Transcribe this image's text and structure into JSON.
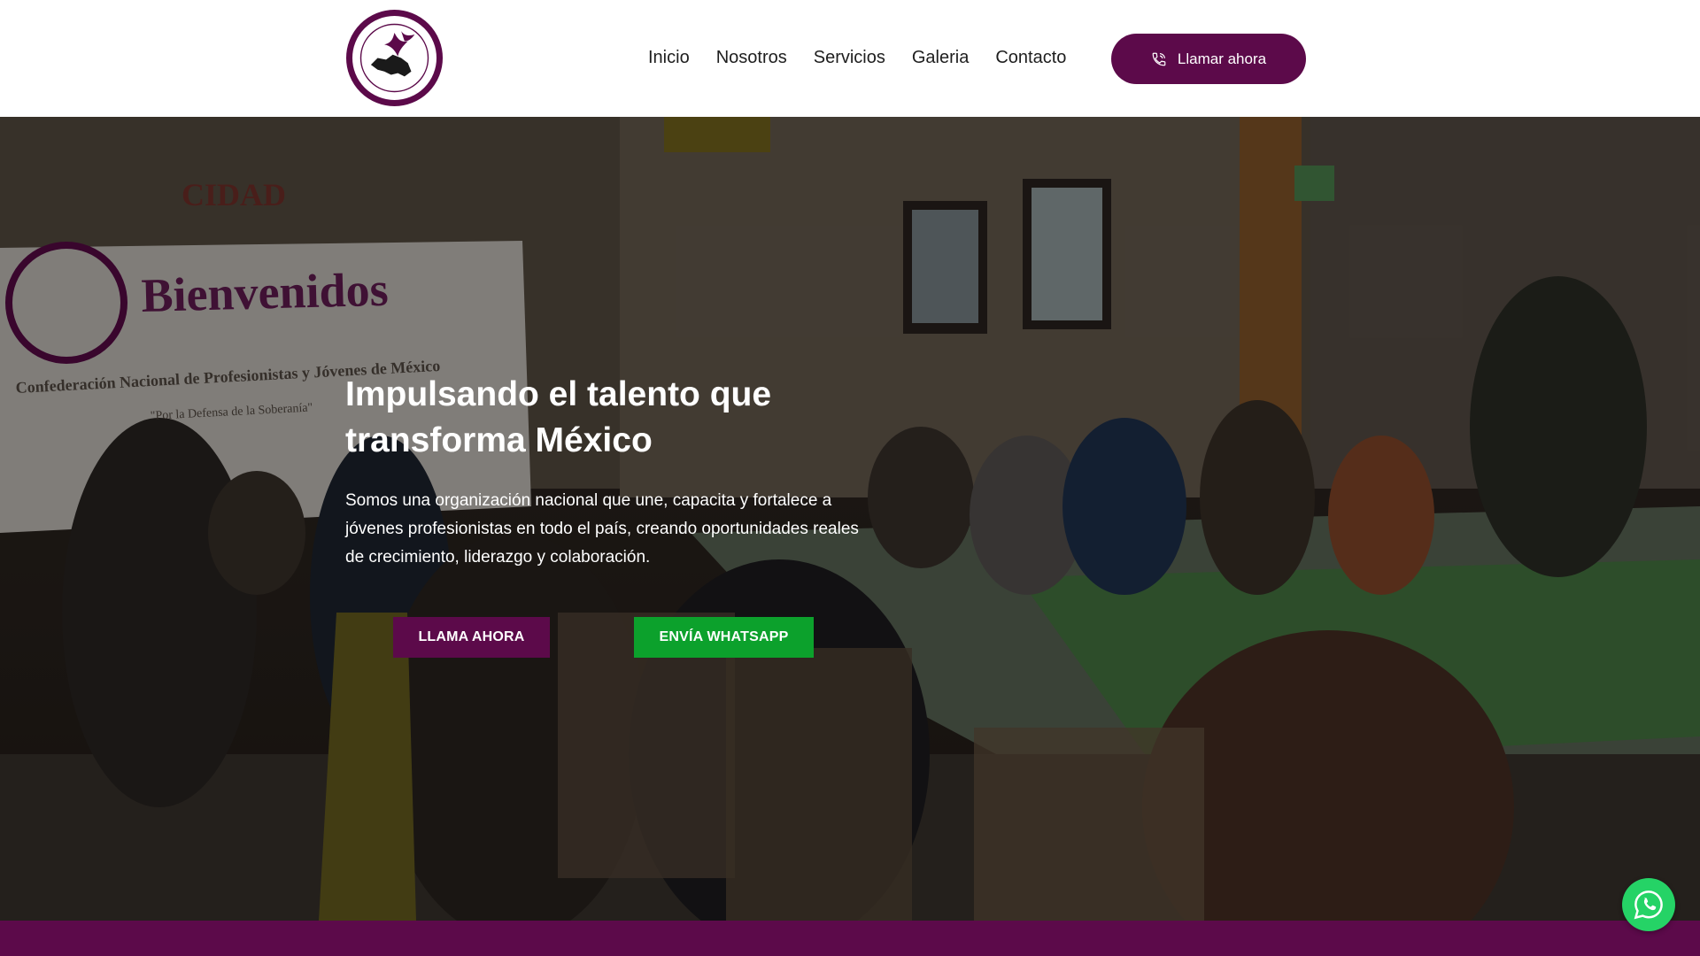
{
  "header": {
    "logo_name": "confederation-logo",
    "nav": [
      {
        "label": "Inicio"
      },
      {
        "label": "Nosotros"
      },
      {
        "label": "Servicios"
      },
      {
        "label": "Galeria"
      },
      {
        "label": "Contacto"
      }
    ],
    "call_button": {
      "label": "Llamar ahora",
      "icon": "phone-icon"
    }
  },
  "hero": {
    "title_line1": "Impulsando el talento que",
    "title_line2": "transforma México",
    "description": "Somos una organización nacional que une, capacita y fortalece a jóvenes profesionistas en todo el país, creando oportunidades reales de crecimiento, liderazgo y colaboración.",
    "primary_button": "LLAMA AHORA",
    "secondary_button": "ENVÍA WHATSAPP",
    "banner_text": {
      "title": "Bienvenidos",
      "subtitle": "Confederación Nacional de Profesionistas y Jóvenes de México",
      "motto": "\"Por la Defensa de la Soberanía\"",
      "sign": "CIDAD"
    }
  },
  "floating": {
    "icon": "whatsapp-icon"
  },
  "colors": {
    "brand": "#5c0a4a",
    "whatsapp_button": "#0ca12c",
    "whatsapp_float": "#25d366",
    "text_dark": "#1e1e1e"
  }
}
